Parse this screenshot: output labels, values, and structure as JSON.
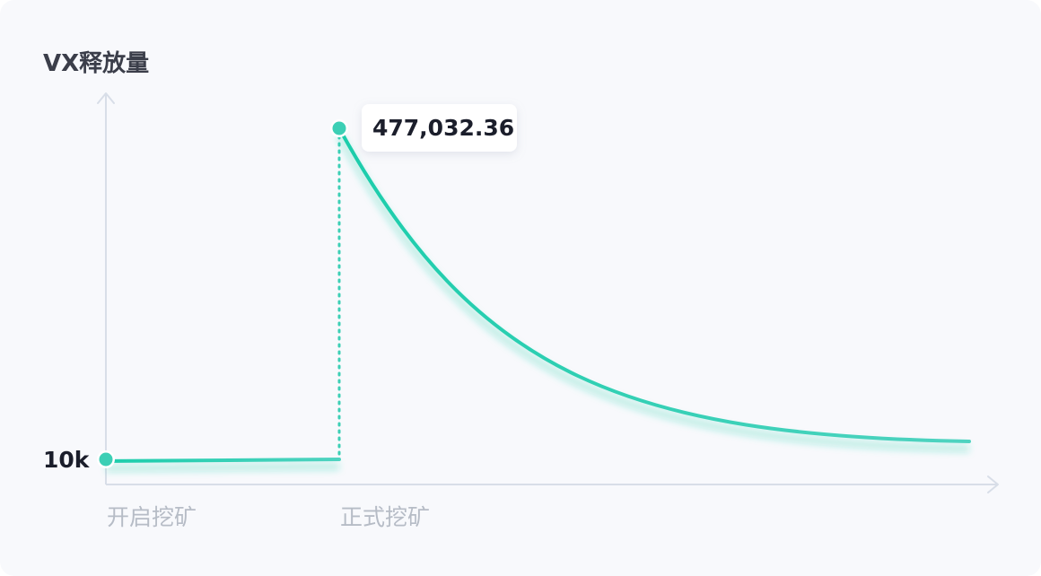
{
  "chart_data": {
    "type": "line",
    "ylabel": "VX释放量",
    "y_tick_label": "10k",
    "x_tick_labels": [
      "开启挖矿",
      "正式挖矿"
    ],
    "peak_label": "477,032.36",
    "colors": {
      "line": "#1fcfae",
      "point": "#3ccfb5",
      "axis": "#d8dee8",
      "ylabel": "#3b3e4a",
      "tick": "#b6bcc6",
      "value": "#1b1e2b"
    }
  }
}
